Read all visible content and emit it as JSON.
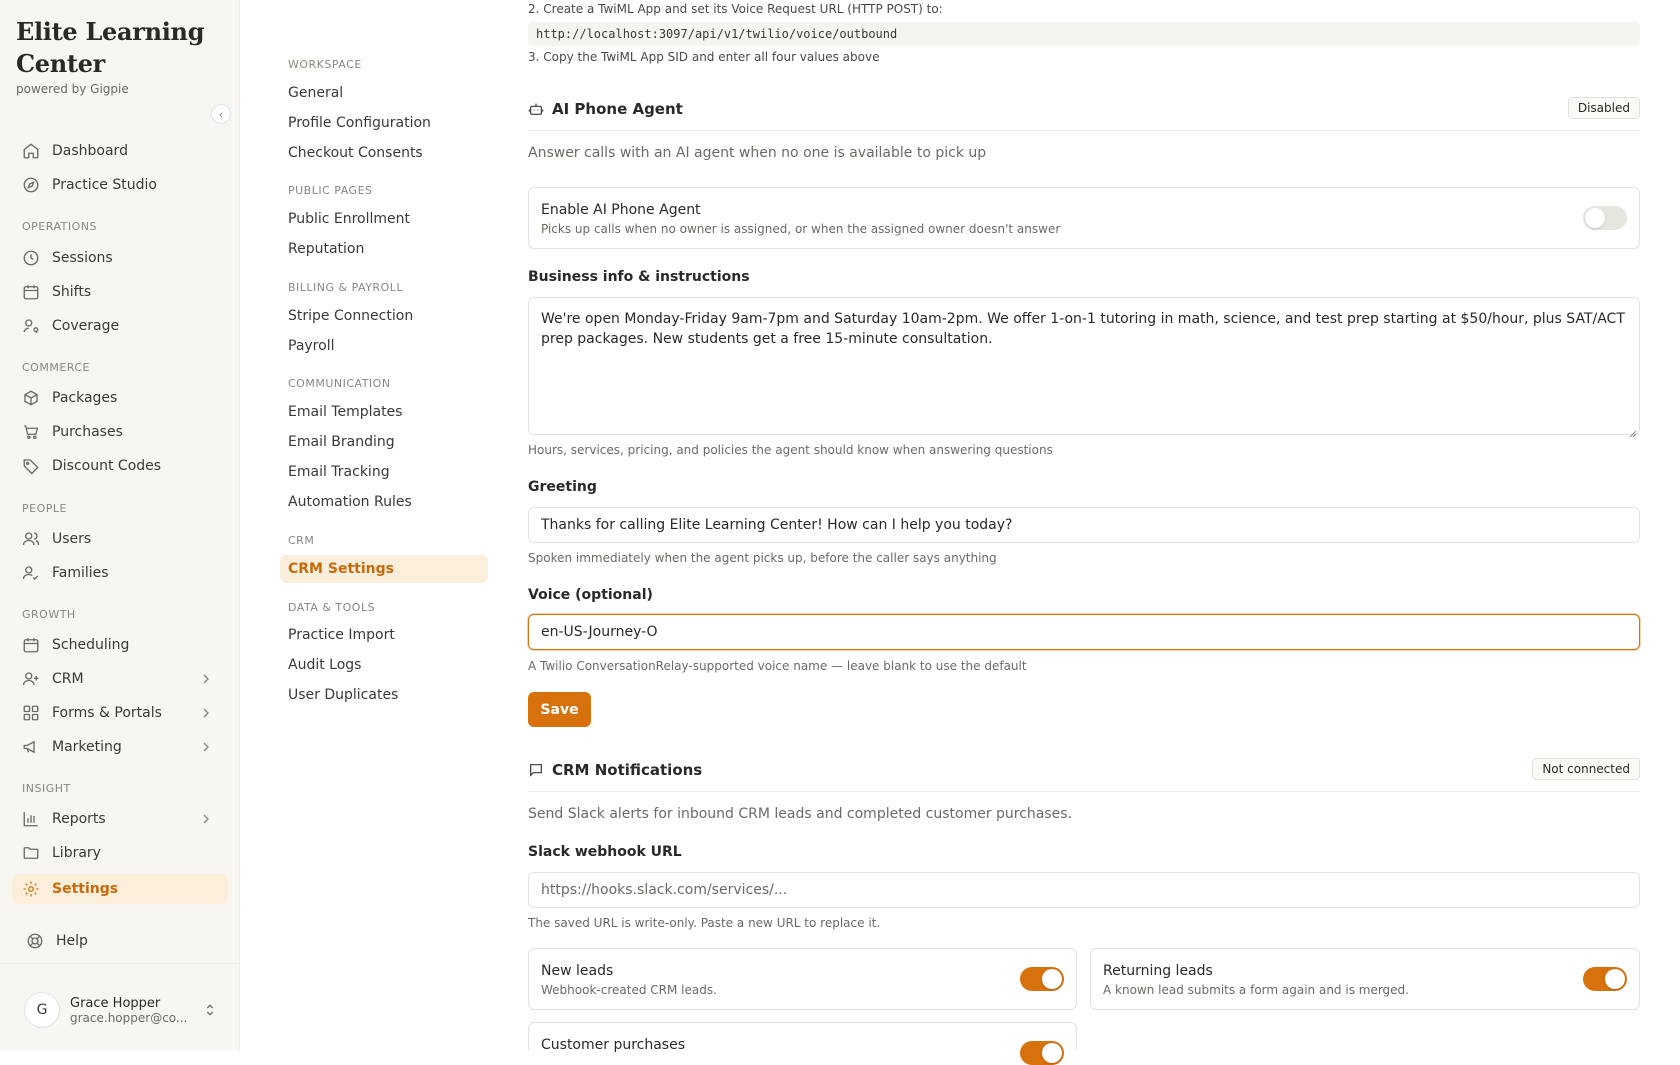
{
  "brand": {
    "title_line1": "Elite Learning",
    "title_line2": "Center",
    "subtitle": "powered by Gigpie"
  },
  "sidebar": {
    "items": [
      {
        "label": "Dashboard",
        "icon": "home-icon"
      },
      {
        "label": "Practice Studio",
        "icon": "compass-icon"
      }
    ],
    "sections": {
      "operations": "OPERATIONS",
      "commerce": "COMMERCE",
      "people": "PEOPLE",
      "growth": "GROWTH",
      "insight": "INSIGHT"
    },
    "operations": [
      {
        "label": "Sessions",
        "icon": "clock-icon"
      },
      {
        "label": "Shifts",
        "icon": "calendar-icon"
      },
      {
        "label": "Coverage",
        "icon": "user-search-icon"
      }
    ],
    "commerce": [
      {
        "label": "Packages",
        "icon": "package-icon"
      },
      {
        "label": "Purchases",
        "icon": "cart-icon"
      },
      {
        "label": "Discount Codes",
        "icon": "tag-icon"
      }
    ],
    "people": [
      {
        "label": "Users",
        "icon": "users-icon"
      },
      {
        "label": "Families",
        "icon": "family-icon"
      }
    ],
    "growth": [
      {
        "label": "Scheduling",
        "icon": "calendar-icon"
      },
      {
        "label": "CRM",
        "icon": "user-plus-icon"
      },
      {
        "label": "Forms & Portals",
        "icon": "grid-icon"
      },
      {
        "label": "Marketing",
        "icon": "megaphone-icon"
      }
    ],
    "insight": [
      {
        "label": "Reports",
        "icon": "bar-chart-icon"
      },
      {
        "label": "Library",
        "icon": "folder-icon"
      },
      {
        "label": "Settings",
        "icon": "gear-icon"
      }
    ],
    "help": "Help",
    "user": {
      "initial": "G",
      "name": "Grace Hopper",
      "email": "grace.hopper@co..."
    }
  },
  "subnav": {
    "workspace": "WORKSPACE",
    "workspace_items": [
      "General",
      "Profile Configuration",
      "Checkout Consents"
    ],
    "public_pages": "PUBLIC PAGES",
    "public_items": [
      "Public Enrollment",
      "Reputation"
    ],
    "billing": "BILLING & PAYROLL",
    "billing_items": [
      "Stripe Connection",
      "Payroll"
    ],
    "communication": "COMMUNICATION",
    "communication_items": [
      "Email Templates",
      "Email Branding",
      "Email Tracking",
      "Automation Rules"
    ],
    "crm": "CRM",
    "crm_items": [
      "CRM Settings"
    ],
    "data_tools": "DATA & TOOLS",
    "data_items": [
      "Practice Import",
      "Audit Logs",
      "User Duplicates"
    ]
  },
  "twilio": {
    "step2": "2. Create a TwiML App and set its Voice Request URL (HTTP POST) to:",
    "url": "http://localhost:3097/api/v1/twilio/voice/outbound",
    "step3": "3. Copy the TwiML App SID and enter all four values above"
  },
  "ai_agent": {
    "title": "AI Phone Agent",
    "status": "Disabled",
    "description": "Answer calls with an AI agent when no one is available to pick up",
    "enable_title": "Enable AI Phone Agent",
    "enable_sub": "Picks up calls when no owner is assigned, or when the assigned owner doesn't answer",
    "enabled": false,
    "business_label": "Business info & instructions",
    "business_value": "We're open Monday-Friday 9am-7pm and Saturday 10am-2pm. We offer 1-on-1 tutoring in math, science, and test prep starting at $50/hour, plus SAT/ACT prep packages. New students get a free 15-minute consultation.",
    "business_help": "Hours, services, pricing, and policies the agent should know when answering questions",
    "greeting_label": "Greeting",
    "greeting_value": "Thanks for calling Elite Learning Center! How can I help you today?",
    "greeting_help": "Spoken immediately when the agent picks up, before the caller says anything",
    "voice_label": "Voice (optional)",
    "voice_value": "en-US-Journey-O",
    "voice_help": "A Twilio ConversationRelay-supported voice name — leave blank to use the default",
    "save_label": "Save"
  },
  "crm_notifications": {
    "title": "CRM Notifications",
    "status": "Not connected",
    "description": "Send Slack alerts for inbound CRM leads and completed customer purchases.",
    "webhook_label": "Slack webhook URL",
    "webhook_placeholder": "https://hooks.slack.com/services/...",
    "webhook_help": "The saved URL is write-only. Paste a new URL to replace it.",
    "new_leads_title": "New leads",
    "new_leads_sub": "Webhook-created CRM leads.",
    "new_leads_on": true,
    "returning_title": "Returning leads",
    "returning_sub": "A known lead submits a form again and is merged.",
    "returning_on": true,
    "purchases_title": "Customer purchases",
    "purchases_on": true
  },
  "colors": {
    "accent": "#d6710c",
    "active_bg": "#fbeedb",
    "sidebar_bg": "#f7f6f3"
  }
}
